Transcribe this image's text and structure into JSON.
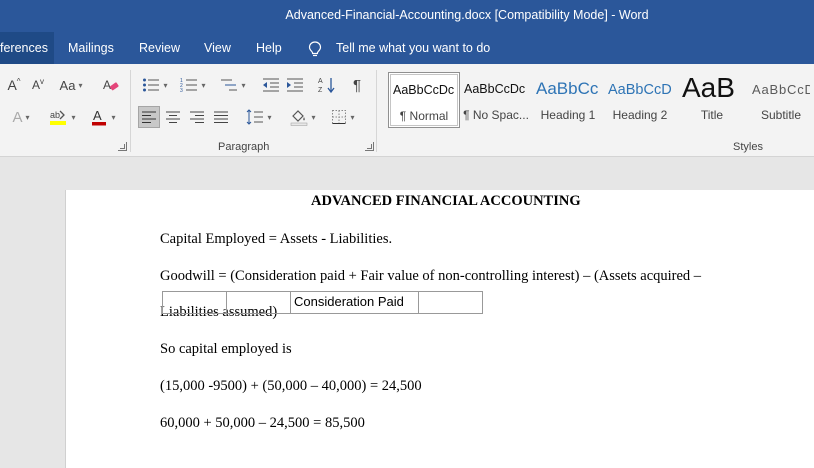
{
  "window": {
    "title": "Advanced-Financial-Accounting.docx [Compatibility Mode]  -  Word"
  },
  "tabs": [
    {
      "label": "ferences",
      "active": true
    },
    {
      "label": "Mailings"
    },
    {
      "label": "Review"
    },
    {
      "label": "View"
    },
    {
      "label": "Help"
    }
  ],
  "tell_me": {
    "placeholder": "Tell me what you want to do"
  },
  "ribbon": {
    "font_group": {
      "grow_font": "A",
      "shrink_font": "A",
      "change_case": "Aa",
      "text_effects": "A",
      "font_color": "A"
    },
    "paragraph_group": {
      "label": "Paragraph"
    },
    "styles_group": {
      "label": "Styles",
      "items": [
        {
          "preview": "AaBbCcDc",
          "name": "¶ Normal",
          "selected": true
        },
        {
          "preview": "AaBbCcDc",
          "name": "¶ No Spac..."
        },
        {
          "preview": "AaBbCc",
          "name": "Heading 1"
        },
        {
          "preview": "AaBbCcD",
          "name": "Heading 2"
        },
        {
          "preview": "AaB",
          "name": "Title"
        },
        {
          "preview": "AaBbCcD",
          "name": "Subtitle"
        }
      ]
    }
  },
  "colors": {
    "brand": "#2b579a",
    "font_color_bar": "#c00000",
    "highlight_bar": "#ffff00"
  },
  "document": {
    "heading": "ADVANCED FINANCIAL ACCOUNTING",
    "lines": [
      "Capital Employed = Assets - Liabilities.",
      "Goodwill = (Consideration paid + Fair value of non-controlling interest) – (Assets acquired –",
      "Liabilities assumed)",
      "So capital employed is",
      "(15,000 -9500) + (50,000 – 40,000) = 24,500",
      "60,000 + 50,000 – 24,500 = 85,500"
    ],
    "table": {
      "cells": [
        "",
        "",
        "Consideration Paid",
        ""
      ]
    }
  }
}
